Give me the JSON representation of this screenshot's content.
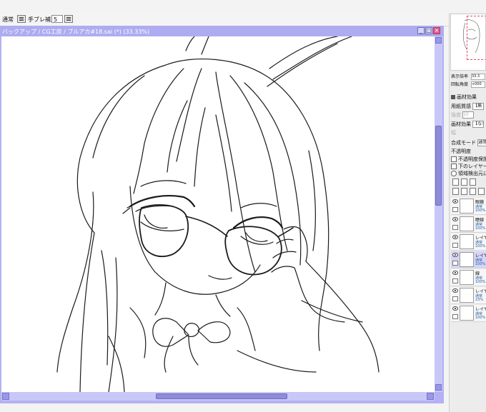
{
  "tool_options": {
    "blend_mode": "通常",
    "stabilizer_label": "手ブレ補正",
    "stabilizer_value": "5"
  },
  "document": {
    "title": "バックアップ / CG工房 / ブルアカ#18.sai (*) (33.33%)",
    "minimize_glyph": "_",
    "maximize_glyph": "□",
    "close_glyph": "×"
  },
  "navigator": {
    "zoom_label": "表示倍率",
    "zoom_value": "33.3",
    "rotate_label": "回転角度",
    "rotate_value": "+000"
  },
  "paper_effects": {
    "header": "画材効果",
    "texture_label": "用紙質感",
    "texture_value": "【無",
    "texture_strength_label": "強度",
    "texture_strength_value": "10",
    "effect_label": "画材効果",
    "effect_value": "【なし",
    "effect_strength_label": "幅"
  },
  "layer_props": {
    "blend_label": "合成モード",
    "blend_value": "通常",
    "opacity_label": "不透明度",
    "preserve_opacity": "不透明度保護",
    "clip_lower": "下のレイヤーでクリ",
    "detect_source": "領域検出元に"
  },
  "layers": [
    {
      "name": "眼鏡",
      "mode": "通常",
      "opacity": "100%",
      "selected": false
    },
    {
      "name": "睫線",
      "mode": "通常",
      "opacity": "100%",
      "selected": false
    },
    {
      "name": "レイヤ",
      "mode": "通常",
      "opacity": "100%",
      "selected": false
    },
    {
      "name": "レイヤ",
      "mode": "通常",
      "opacity": "100%",
      "selected": true
    },
    {
      "name": "線",
      "mode": "通常",
      "opacity": "100%",
      "selected": false
    },
    {
      "name": "レイヤ",
      "mode": "通常",
      "opacity": "23%",
      "selected": false
    },
    {
      "name": "レイヤ",
      "mode": "通常",
      "opacity": "100%",
      "selected": false
    }
  ],
  "colors": {
    "window_accent": "#aeacf0",
    "close_button": "#e05c86",
    "selected_layer": "#d6d5f7"
  }
}
